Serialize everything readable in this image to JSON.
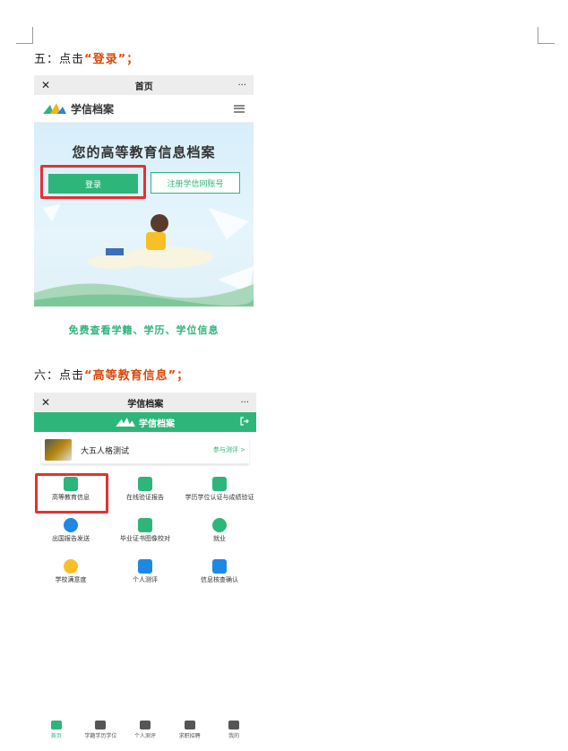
{
  "step5": {
    "prefix": "五：点击",
    "open_quote": "“",
    "highlight": "登录",
    "close_quote": "”；"
  },
  "shot1": {
    "topbar": {
      "close": "✕",
      "title": "首页",
      "more": "···"
    },
    "logo_text": "学信档案",
    "hero_title": "您的高等教育信息档案",
    "login_label": "登录",
    "register_label": "注册学信网账号"
  },
  "free_line": "免费查看学籍、学历、学位信息",
  "step6": {
    "prefix": "六：点击",
    "open_quote": "“",
    "highlight": "高等教育信息",
    "close_quote": "”；"
  },
  "shot2": {
    "topbar": {
      "close": "✕",
      "title": "学信档案",
      "more": "···"
    },
    "brand": "学信档案",
    "test_title": "大五人格测试",
    "test_link": "参与测评 >",
    "items": [
      {
        "label": "高等教育信息",
        "icon": "graduate-icon",
        "color": "#2eb57a"
      },
      {
        "label": "在线验证报告",
        "icon": "shield-check-icon",
        "color": "#2eb57a"
      },
      {
        "label": "学历学位认证与成绩验证",
        "icon": "id-card-icon",
        "color": "#2eb57a"
      },
      {
        "label": "出国报告发送",
        "icon": "globe-icon",
        "color": "#1e88e5"
      },
      {
        "label": "毕业证书图像校对",
        "icon": "user-check-icon",
        "color": "#2eb57a"
      },
      {
        "label": "就业",
        "icon": "offer-icon",
        "color": "#2eb57a"
      },
      {
        "label": "学校满意度",
        "icon": "smile-icon",
        "color": "#f6c026"
      },
      {
        "label": "个人测评",
        "icon": "clipboard-check-icon",
        "color": "#1e88e5"
      },
      {
        "label": "信息核查确认",
        "icon": "shield-user-icon",
        "color": "#1e88e5"
      }
    ]
  },
  "tabbar": [
    {
      "label": "首页",
      "icon": "home-icon"
    },
    {
      "label": "学籍学历学位",
      "icon": "cap-icon"
    },
    {
      "label": "个人测评",
      "icon": "clipboard-icon"
    },
    {
      "label": "求职招聘",
      "icon": "briefcase-icon"
    },
    {
      "label": "我的",
      "icon": "user-icon"
    }
  ],
  "colors": {
    "accent": "#2eb57a",
    "highlight": "#d94a0c",
    "redbox": "#e53131"
  }
}
